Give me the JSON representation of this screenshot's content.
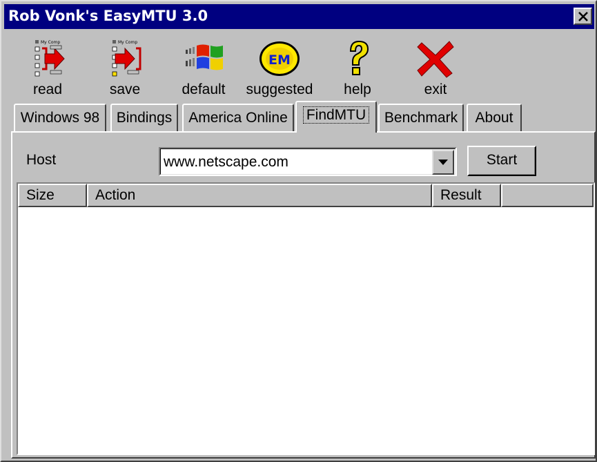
{
  "window": {
    "title": "Rob Vonk's EasyMTU 3.0"
  },
  "toolbar": {
    "buttons": [
      {
        "label": "read",
        "icon": "read-settings-icon"
      },
      {
        "label": "save",
        "icon": "save-settings-icon"
      },
      {
        "label": "default",
        "icon": "windows-logo-icon"
      },
      {
        "label": "suggested",
        "icon": "em-badge-icon",
        "icon_text": "EM"
      },
      {
        "label": "help",
        "icon": "question-mark-icon"
      },
      {
        "label": "exit",
        "icon": "red-x-icon"
      }
    ],
    "icon_caption": "My Comp"
  },
  "tabs": [
    {
      "label": "Windows 98"
    },
    {
      "label": "Bindings"
    },
    {
      "label": "America Online"
    },
    {
      "label": "FindMTU",
      "active": true
    },
    {
      "label": "Benchmark"
    },
    {
      "label": "About"
    }
  ],
  "findmtu": {
    "host_label": "Host",
    "host_value": "www.netscape.com",
    "start_label": "Start",
    "columns": [
      "Size",
      "Action",
      "Result",
      ""
    ],
    "rows": []
  },
  "colors": {
    "titlebar": "#000080",
    "face": "#c0c0c0",
    "exit_red": "#e00000",
    "help_yellow": "#f0e000"
  }
}
